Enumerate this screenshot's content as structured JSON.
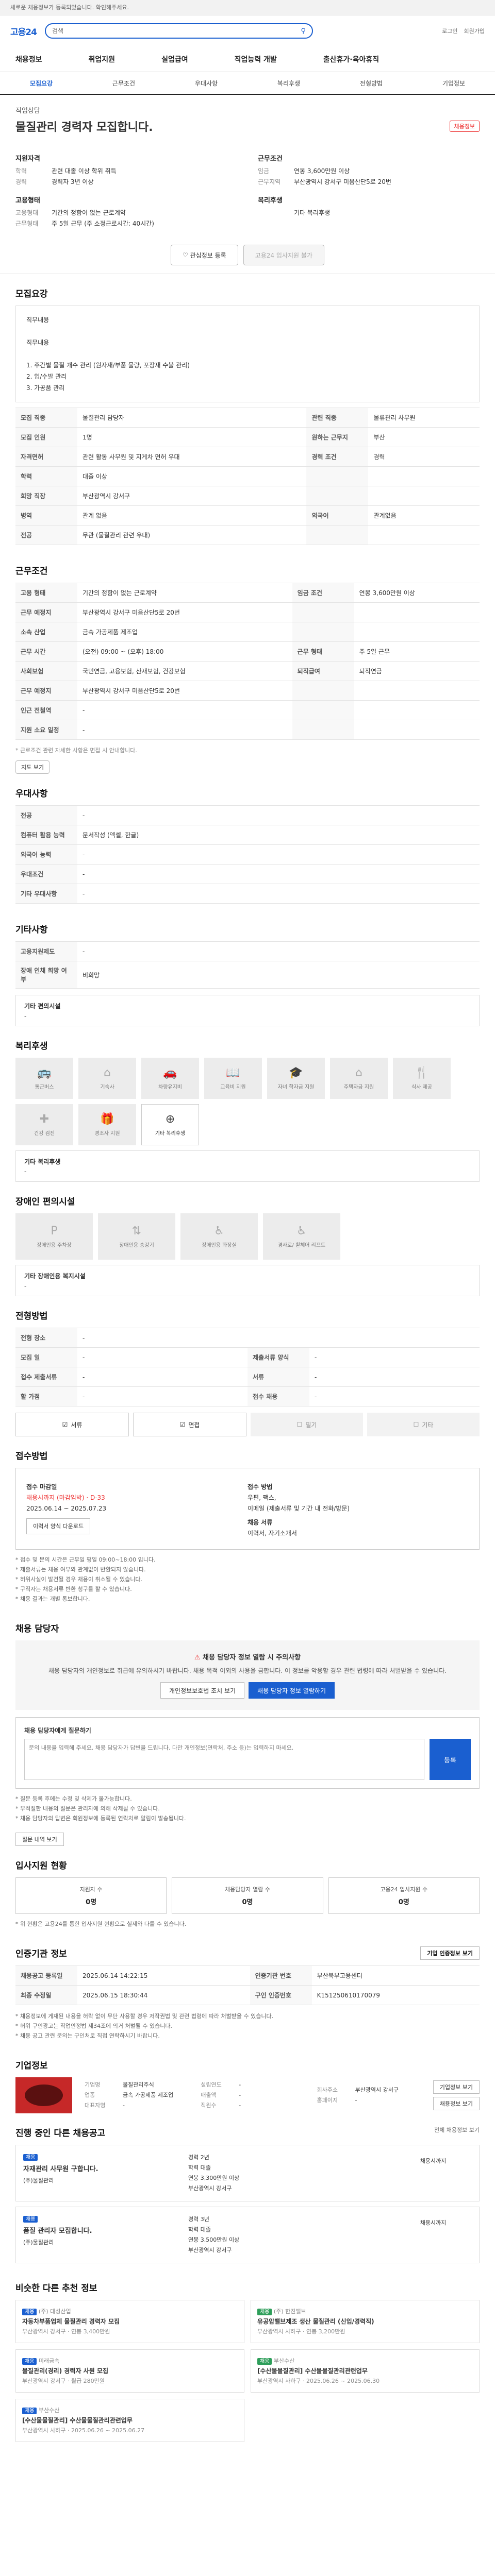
{
  "top_notice": "새로운 채용정보가 등록되었습니다. 확인해주세요.",
  "site": {
    "logo": "고용24",
    "search_placeholder": "검색",
    "user_menu": [
      "로그인",
      "회원가입"
    ]
  },
  "gnb": [
    "채용정보",
    "취업지원",
    "실업급여",
    "직업능력 개발",
    "출산휴가·육아휴직"
  ],
  "tabs": [
    "모집요강",
    "근무조건",
    "우대사항",
    "복리후생",
    "전형방법",
    "기업정보"
  ],
  "hero": {
    "company": "직업상담",
    "title": "물질관리 경력자 모집합니다.",
    "badge": "채용정보",
    "col1_head": "지원자격",
    "col1": [
      {
        "k": "학력",
        "v": "관련 대졸 이상 학위 취득"
      },
      {
        "k": "경력",
        "v": "경력자 3년 이상"
      }
    ],
    "col1b_head": "고용형태",
    "col1b": [
      {
        "k": "고용형태",
        "v": "기간의 정함이 없는 근로계약"
      },
      {
        "k": "근무형태",
        "v": "주 5일 근무 (주 소정근로시간: 40시간)"
      }
    ],
    "col2_head": "근무조건",
    "col2": [
      {
        "k": "임금",
        "v": "연봉 3,600만원 이상"
      },
      {
        "k": "근무지역",
        "v": "부산광역시 강서구 미음산단5로 20번"
      }
    ],
    "col2b_head": "복리후생",
    "col2b": [
      {
        "k": "",
        "v": "기타 복리후생"
      }
    ],
    "btn_interest": "관심정보 등록",
    "btn_apply": "고용24 입사지원 불가"
  },
  "recruit": {
    "title": "모집요강",
    "desc": "직무내용\n\n직무내용\n\n1. 주간별 물질 개수 관리 (원자재/부품 물량, 포장재 수불 관리)\n2. 입/수발 관리\n3. 가공품 관리",
    "rows": [
      [
        "모집 직종",
        "물질관리 담당자",
        "관련 직종",
        "물류관리 사무원"
      ],
      [
        "모집 인원",
        "1명",
        "원하는 근무지",
        "부산"
      ],
      [
        "자격면허",
        "관련 활동 사무원 및 지게차 면허 우대",
        "경력 조건",
        "경력"
      ],
      [
        "학력",
        "대졸 이상",
        "",
        ""
      ],
      [
        "희망 직장",
        "부산광역시 강서구",
        "",
        ""
      ],
      [
        "병역",
        "관계 없음",
        "외국어",
        "관계없음"
      ],
      [
        "전공",
        "무관 (물질관리 관련 우대)",
        "",
        ""
      ]
    ]
  },
  "work": {
    "title": "근무조건",
    "rows": [
      [
        "고용 형태",
        "기간의 정함이 없는 근로계약",
        "임금 조건",
        "연봉 3,600만원 이상"
      ],
      [
        "근무 예정지",
        "부산광역시 강서구 미음산단5로 20번",
        "",
        ""
      ],
      [
        "소속 산업",
        "금속 가공제품 제조업",
        "",
        ""
      ],
      [
        "근무 시간",
        "(오전) 09:00 ~ (오후) 18:00",
        "근무 형태",
        "주 5일 근무"
      ],
      [
        "사회보험",
        "국민연금, 고용보험, 산재보험, 건강보험",
        "퇴직급여",
        "퇴직연금"
      ],
      [
        "근무 예정지",
        "부산광역시 강서구 미음산단5로 20번",
        "",
        ""
      ],
      [
        "인근 전철역",
        "-",
        "",
        ""
      ],
      [
        "지원 소요 일정",
        "-",
        "",
        ""
      ]
    ],
    "note": "* 근로조건 관련 자세한 사항은 면접 시 안내합니다.",
    "map_btn": "지도 보기"
  },
  "prefer": {
    "title": "우대사항",
    "rows": [
      [
        "전공",
        "-"
      ],
      [
        "컴퓨터 활용 능력",
        "문서작성 (엑셀, 한글)"
      ],
      [
        "외국어 능력",
        "-"
      ],
      [
        "우대조건",
        "-"
      ],
      [
        "기타 우대사항",
        "-"
      ]
    ]
  },
  "disabled": {
    "title": "기타사항",
    "rows": [
      [
        "고용지원제도",
        "-"
      ],
      [
        "장애 인채 희망 여부",
        "비희망"
      ]
    ],
    "free_head": "기타 편의시설",
    "free_text": "-"
  },
  "benefit": {
    "title": "복리후생",
    "icons": [
      {
        "label": "통근버스",
        "icon": "bus-icon",
        "on": false
      },
      {
        "label": "기숙사",
        "icon": "home-icon",
        "on": false
      },
      {
        "label": "차량유지비",
        "icon": "car-icon",
        "on": false
      },
      {
        "label": "교육비 지원",
        "icon": "book-icon",
        "on": false
      },
      {
        "label": "자녀 학자금 지원",
        "icon": "cap-icon",
        "on": false
      },
      {
        "label": "주택자금 지원",
        "icon": "house-icon",
        "on": false
      },
      {
        "label": "식사 제공",
        "icon": "meal-icon",
        "on": false
      },
      {
        "label": "건강 검진",
        "icon": "health-icon",
        "on": false
      },
      {
        "label": "경조사 지원",
        "icon": "gift-icon",
        "on": false
      },
      {
        "label": "기타 복리후생",
        "icon": "plus-icon",
        "on": true
      }
    ],
    "etc_head": "기타 복리후생",
    "etc": "-"
  },
  "facility": {
    "title": "장애인 편의시설",
    "icons": [
      {
        "label": "장애인용 주차장",
        "icon": "parking-icon"
      },
      {
        "label": "장애인용 승강기",
        "icon": "elevator-icon"
      },
      {
        "label": "장애인용 화장실",
        "icon": "toilet-icon"
      },
      {
        "label": "경사로/ 휠체어 리프트",
        "icon": "ramp-icon"
      }
    ],
    "etc_head": "기타 장애인용 복지시설",
    "etc": "-"
  },
  "selection": {
    "title": "전형방법",
    "rows": [
      [
        "전형 장소",
        "-"
      ],
      [
        "모집 일",
        "-",
        "제출서류 양식",
        "-"
      ],
      [
        "접수 제출서류",
        "-",
        "서류",
        "-"
      ],
      [
        "할 가점",
        "-",
        "접수 채용",
        "-"
      ]
    ],
    "methods": [
      {
        "label": "서류",
        "on": true
      },
      {
        "label": "면접",
        "on": true
      },
      {
        "label": "필기",
        "on": false
      },
      {
        "label": "기타",
        "on": false
      }
    ]
  },
  "apply": {
    "title": "접수방법",
    "deadline_head": "접수 마감일",
    "deadline": "채용시까지 (마감임박) · D-33",
    "period": "2025.06.14 ~ 2025.07.23",
    "method_head": "접수 방법",
    "method": "우편, 팩스,",
    "method2": "이메일 (제출서류 및 기간 내 전화/방문)",
    "email_head": "채용 서류",
    "email": "이력서, 자기소개서",
    "copy_btn": "이력서 양식 다운로드",
    "notes": [
      "* 접수 및 문의 시간은 근무일 평일 09:00~18:00 입니다.",
      "* 제출서류는 채용 여부와 관계없이 반환되지 않습니다.",
      "* 허위사실이 발견될 경우 채용이 취소될 수 있습니다.",
      "* 구직자는 채용서류 반환 청구를 할 수 있습니다.",
      "* 채용 결과는 개별 통보합니다."
    ]
  },
  "contact": {
    "title": "채용 담당자",
    "warn_title": "채용 담당자 정보 열람 시 주의사항",
    "warn_text": "채용 담당자의 개인정보로 취급에 유의하시기 바랍니다. 채용 목적 이외의 사용을 금합니다. 이 정보를 악용할 경우 관련 법령에 따라 처벌받을 수 있습니다.",
    "btn_privacy": "개인정보보호법 조치 보기",
    "btn_view": "채용 담당자 정보 열람하기",
    "q_title": "채용 담당자에게 질문하기",
    "q_placeholder": "문의 내용을 입력해 주세요. 채용 담당자가 답변을 드립니다. 다만 개인정보(연락처, 주소 등)는 입력하지 마세요.",
    "q_btn": "등록",
    "bullets": [
      "* 질문 등록 후에는 수정 및 삭제가 불가능합니다.",
      "* 부적절한 내용의 질문은 관리자에 의해 삭제될 수 있습니다.",
      "* 채용 담당자의 답변은 회원정보에 등록된 연락처로 알림이 발송됩니다."
    ],
    "more_btn": "질문 내역 보기"
  },
  "status": {
    "title": "입사지원 현황",
    "cards": [
      {
        "label": "지원자 수",
        "value": "0명"
      },
      {
        "label": "채용담당자 열람 수",
        "value": "0명"
      },
      {
        "label": "고용24 입사지원 수",
        "value": "0명"
      }
    ],
    "note": "* 위 현황은 고용24를 통한 입사지원 현황으로 실제와 다를 수 있습니다."
  },
  "info": {
    "title": "인증기관 정보",
    "btn": "기업 인증정보 보기",
    "rows": [
      [
        "채용공고 등록일",
        "2025.06.14 14:22:15",
        "인증기관 번호",
        "부산북부고용센터"
      ],
      [
        "최종 수정일",
        "2025.06.15 18:30:44",
        "구인 인증번호",
        "K151250610170079"
      ]
    ],
    "notes": [
      "* 채용정보에 게재된 내용을 허락 없이 무단 사용할 경우 저작권법 및 관련 법령에 따라 처벌받을 수 있습니다.",
      "* 허위 구인광고는 직업안정법 제34조에 의거 처벌될 수 있습니다.",
      "* 채용 공고 관련 문의는 구인처로 직접 연락하시기 바랍니다."
    ]
  },
  "company": {
    "title": "기업정보",
    "c1": [
      [
        "기업명",
        "물질관리주식"
      ],
      [
        "업종",
        "금속 가공제품 제조업"
      ],
      [
        "대표자명",
        "-"
      ]
    ],
    "c2": [
      [
        "설립연도",
        "-"
      ],
      [
        "매출액",
        "-"
      ],
      [
        "직원수",
        "-"
      ]
    ],
    "c3": [
      [
        "회사주소",
        "부산광역시 강서구"
      ],
      [
        "홈페이지",
        "-"
      ]
    ],
    "btn1": "기업정보 보기",
    "btn2": "채용정보 보기"
  },
  "others": {
    "title": "진행 중인 다른 채용공고",
    "more": "전체 채용정보 보기",
    "items": [
      {
        "tag": "채용",
        "title": "자재관리 사무원 구합니다.",
        "sub": "(주)물질관리",
        "info": [
          "경력 2년",
          "학력 대졸",
          "연봉 3,300만원 이상",
          "부산광역시 강서구"
        ],
        "d": "채용시까지"
      },
      {
        "tag": "채용",
        "title": "품질 관리자 모집합니다.",
        "sub": "(주)물질관리",
        "info": [
          "경력 3년",
          "학력 대졸",
          "연봉 3,500만원 이상",
          "부산광역시 강서구"
        ],
        "d": "채용시까지"
      }
    ]
  },
  "recommend": {
    "title": "비슷한 다른 추천 정보",
    "items": [
      {
        "tag": "채용",
        "title": "자동차부품업체 물질관리 경력자 모집",
        "sub": "(주) 대성산업",
        "meta": "부산광역시 강서구 · 연봉 3,400만원"
      },
      {
        "tag": "채용",
        "title": "유공압밸브제조 생산 물질관리 (신입/경력직)",
        "sub": "(주) 한진밸브",
        "meta": "부산광역시 사하구 · 연봉 3,200만원"
      },
      {
        "tag": "채용",
        "title": "물질관리(경리) 경력자 사원 모집",
        "sub": "미래금속",
        "meta": "부산광역시 강서구 · 월급 280만원"
      },
      {
        "tag": "채용",
        "title": "[수산물물질관리] 수산물물질관리관련업무",
        "sub": "부산수산",
        "meta": "부산광역시 사하구 · 2025.06.26 ~ 2025.06.30"
      },
      {
        "tag": "채용",
        "title": "[수산물물질관리] 수산물물질관리관련업무",
        "sub": "부산수산",
        "meta": "부산광역시 사하구 · 2025.06.26 ~ 2025.06.27"
      }
    ]
  },
  "colors": {
    "accent": "#1a5fd0",
    "alert": "#e33333"
  }
}
